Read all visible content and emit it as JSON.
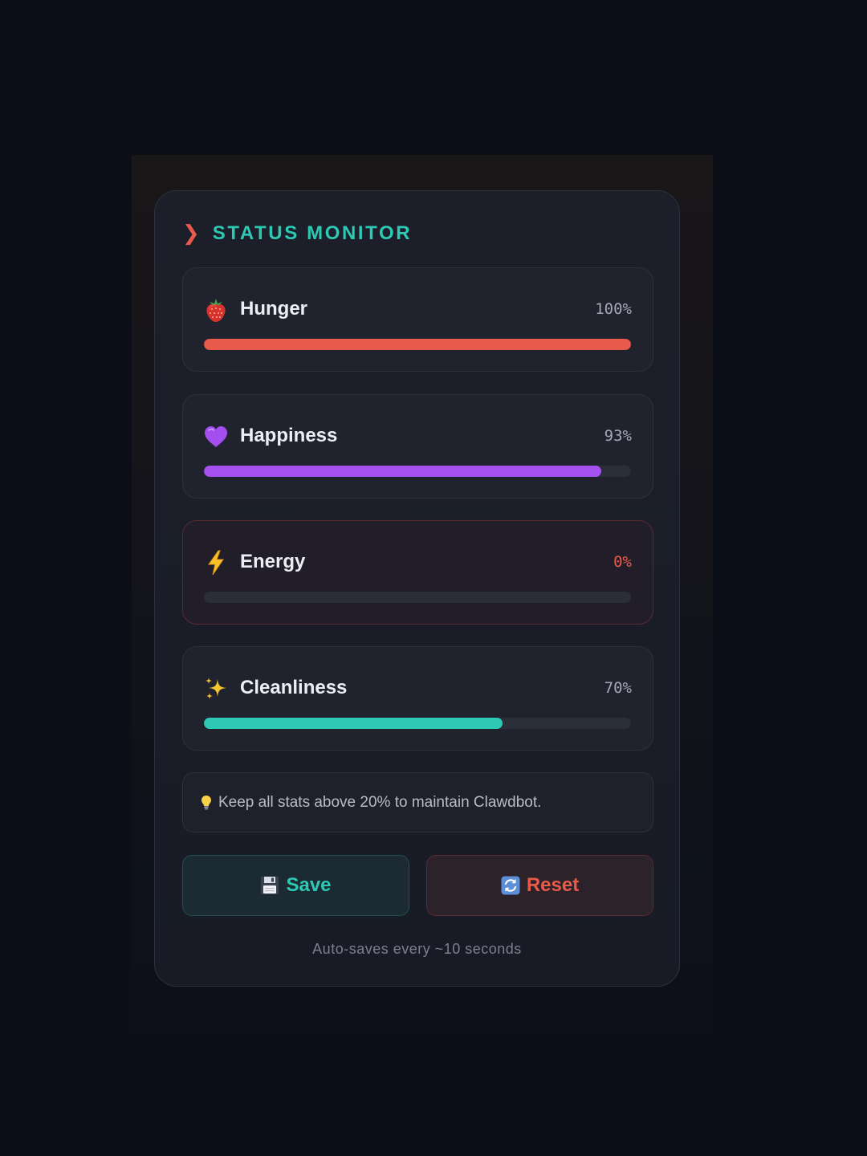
{
  "header": {
    "chevron": "❯",
    "title": "STATUS MONITOR"
  },
  "stats": [
    {
      "label": "Hunger",
      "value_text": "100%",
      "value": 1.0,
      "color": "#e85a4a",
      "icon": "strawberry-icon"
    },
    {
      "label": "Happiness",
      "value_text": "93%",
      "value": 0.93,
      "color": "#a451f0",
      "icon": "purple-heart-icon"
    },
    {
      "label": "Energy",
      "value_text": "0%",
      "value": 0.0,
      "color": "#e85a4a",
      "icon": "lightning-icon"
    },
    {
      "label": "Cleanliness",
      "value_text": "70%",
      "value": 0.7,
      "color": "#2ec9b4",
      "icon": "sparkles-icon"
    }
  ],
  "tip": {
    "icon": "lightbulb-icon",
    "text": "Keep all stats above 20% to maintain Clawdbot."
  },
  "buttons": {
    "save_label": "Save",
    "save_icon": "floppy-disk-icon",
    "reset_label": "Reset",
    "reset_icon": "refresh-icon"
  },
  "footer": "Auto-saves every ~10 seconds",
  "colors": {
    "accent_teal": "#2ec9b4",
    "accent_red": "#e85a4a",
    "accent_purple": "#a451f0"
  }
}
